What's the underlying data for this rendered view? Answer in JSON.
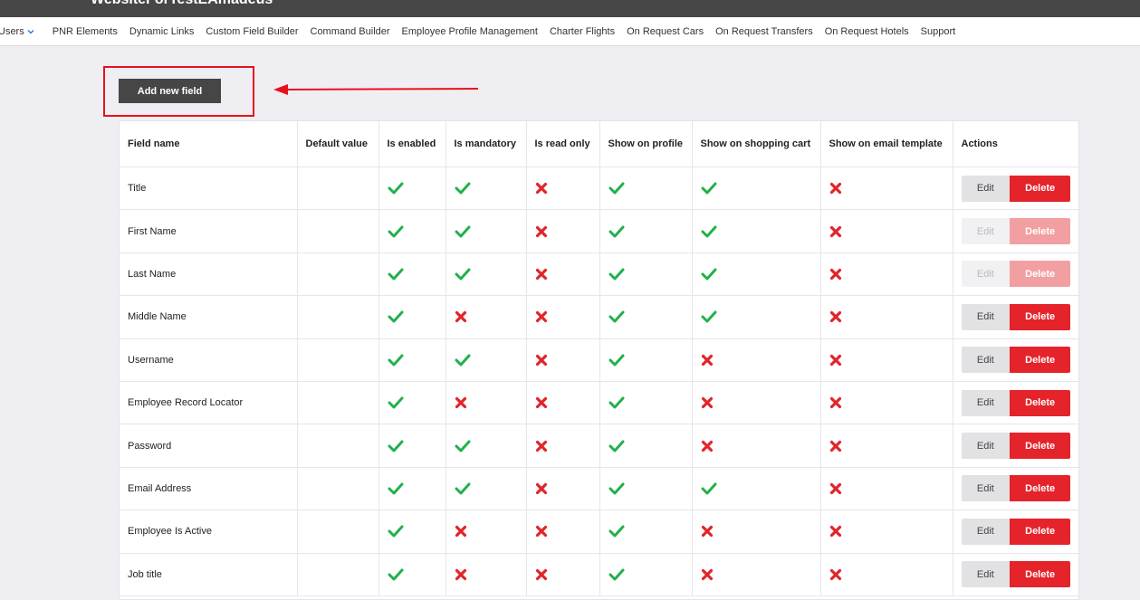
{
  "site_title": "WebsiteForTestEAmadeus",
  "menu": [
    {
      "label": "Users",
      "dropdown": true
    },
    {
      "label": "PNR Elements"
    },
    {
      "label": "Dynamic Links"
    },
    {
      "label": "Custom Field Builder"
    },
    {
      "label": "Command Builder"
    },
    {
      "label": "Employee Profile Management"
    },
    {
      "label": "Charter Flights"
    },
    {
      "label": "On Request Cars"
    },
    {
      "label": "On Request Transfers"
    },
    {
      "label": "On Request Hotels"
    },
    {
      "label": "Support"
    }
  ],
  "add_button_label": "Add new field",
  "annotation_color": "#e8111b",
  "columns": [
    "Field name",
    "Default value",
    "Is enabled",
    "Is mandatory",
    "Is read only",
    "Show on profile",
    "Show on shopping cart",
    "Show on email template",
    "Actions"
  ],
  "rows": [
    {
      "name": "Title",
      "default": "",
      "flags": [
        true,
        true,
        false,
        true,
        true,
        false
      ],
      "actions_disabled": false
    },
    {
      "name": "First Name",
      "default": "",
      "flags": [
        true,
        true,
        false,
        true,
        true,
        false
      ],
      "actions_disabled": true
    },
    {
      "name": "Last Name",
      "default": "",
      "flags": [
        true,
        true,
        false,
        true,
        true,
        false
      ],
      "actions_disabled": true
    },
    {
      "name": "Middle Name",
      "default": "",
      "flags": [
        true,
        false,
        false,
        true,
        true,
        false
      ],
      "actions_disabled": false
    },
    {
      "name": "Username",
      "default": "",
      "flags": [
        true,
        true,
        false,
        true,
        false,
        false
      ],
      "actions_disabled": false
    },
    {
      "name": "Employee Record Locator",
      "default": "",
      "flags": [
        true,
        false,
        false,
        true,
        false,
        false
      ],
      "actions_disabled": false
    },
    {
      "name": "Password",
      "default": "",
      "flags": [
        true,
        true,
        false,
        true,
        false,
        false
      ],
      "actions_disabled": false
    },
    {
      "name": "Email Address",
      "default": "",
      "flags": [
        true,
        true,
        false,
        true,
        true,
        false
      ],
      "actions_disabled": false
    },
    {
      "name": "Employee Is Active",
      "default": "",
      "flags": [
        true,
        false,
        false,
        true,
        false,
        false
      ],
      "actions_disabled": false
    },
    {
      "name": "Job title",
      "default": "",
      "flags": [
        true,
        false,
        false,
        true,
        false,
        false
      ],
      "actions_disabled": false
    }
  ],
  "edit_label": "Edit",
  "delete_label": "Delete",
  "colors": {
    "check": "#22b04b",
    "cross": "#e0252b",
    "delete": "#e4232a",
    "header": "#474747"
  },
  "icons": {
    "true": "check-icon",
    "false": "cross-icon"
  }
}
